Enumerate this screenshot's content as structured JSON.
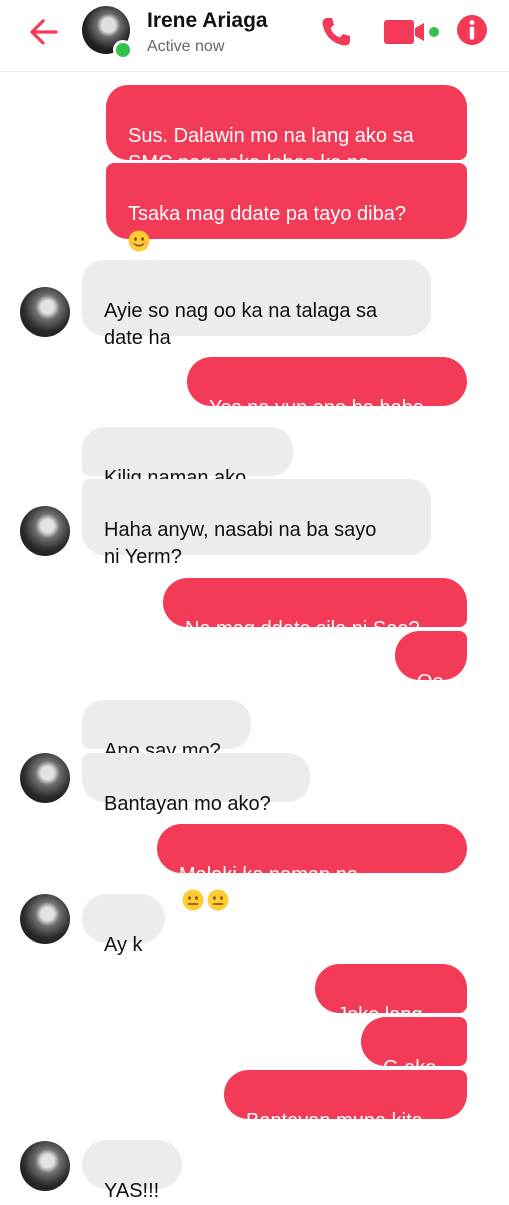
{
  "header": {
    "name": "Irene Ariaga",
    "status": "Active now"
  },
  "colors": {
    "accent": "#f33a57",
    "incoming_bubble": "#ececec",
    "online": "#31c24c"
  },
  "messages": [
    {
      "sender": "me",
      "text": "Sus. Dalawin mo na lang ako sa\nSMC pag naka-labas ka na"
    },
    {
      "sender": "me",
      "text": "Tsaka mag ddate pa tayo diba?",
      "emoji": [
        "smiling-face"
      ]
    },
    {
      "sender": "contact",
      "text": "Ayie so nag oo ka na talaga sa\ndate ha"
    },
    {
      "sender": "me",
      "text": "Yes na yun ano ba haha"
    },
    {
      "sender": "contact",
      "text": "Kilig naman ako."
    },
    {
      "sender": "contact",
      "text": "Haha anyw, nasabi na ba sayo\nni Yerm?"
    },
    {
      "sender": "me",
      "text": "Na mag ddate sila ni Sae?"
    },
    {
      "sender": "me",
      "text": "Oo"
    },
    {
      "sender": "contact",
      "text": "Ano say mo?"
    },
    {
      "sender": "contact",
      "text": "Bantayan mo ako?"
    },
    {
      "sender": "me",
      "text": "Malaki ka naman na.",
      "emoji": [
        "neutral-face",
        "neutral-face"
      ]
    },
    {
      "sender": "contact",
      "text": "Ay k"
    },
    {
      "sender": "me",
      "text": "Joke lang..."
    },
    {
      "sender": "me",
      "text": "G ako."
    },
    {
      "sender": "me",
      "text": "Bantayan muna kita"
    },
    {
      "sender": "contact",
      "text": "YAS!!!"
    }
  ]
}
